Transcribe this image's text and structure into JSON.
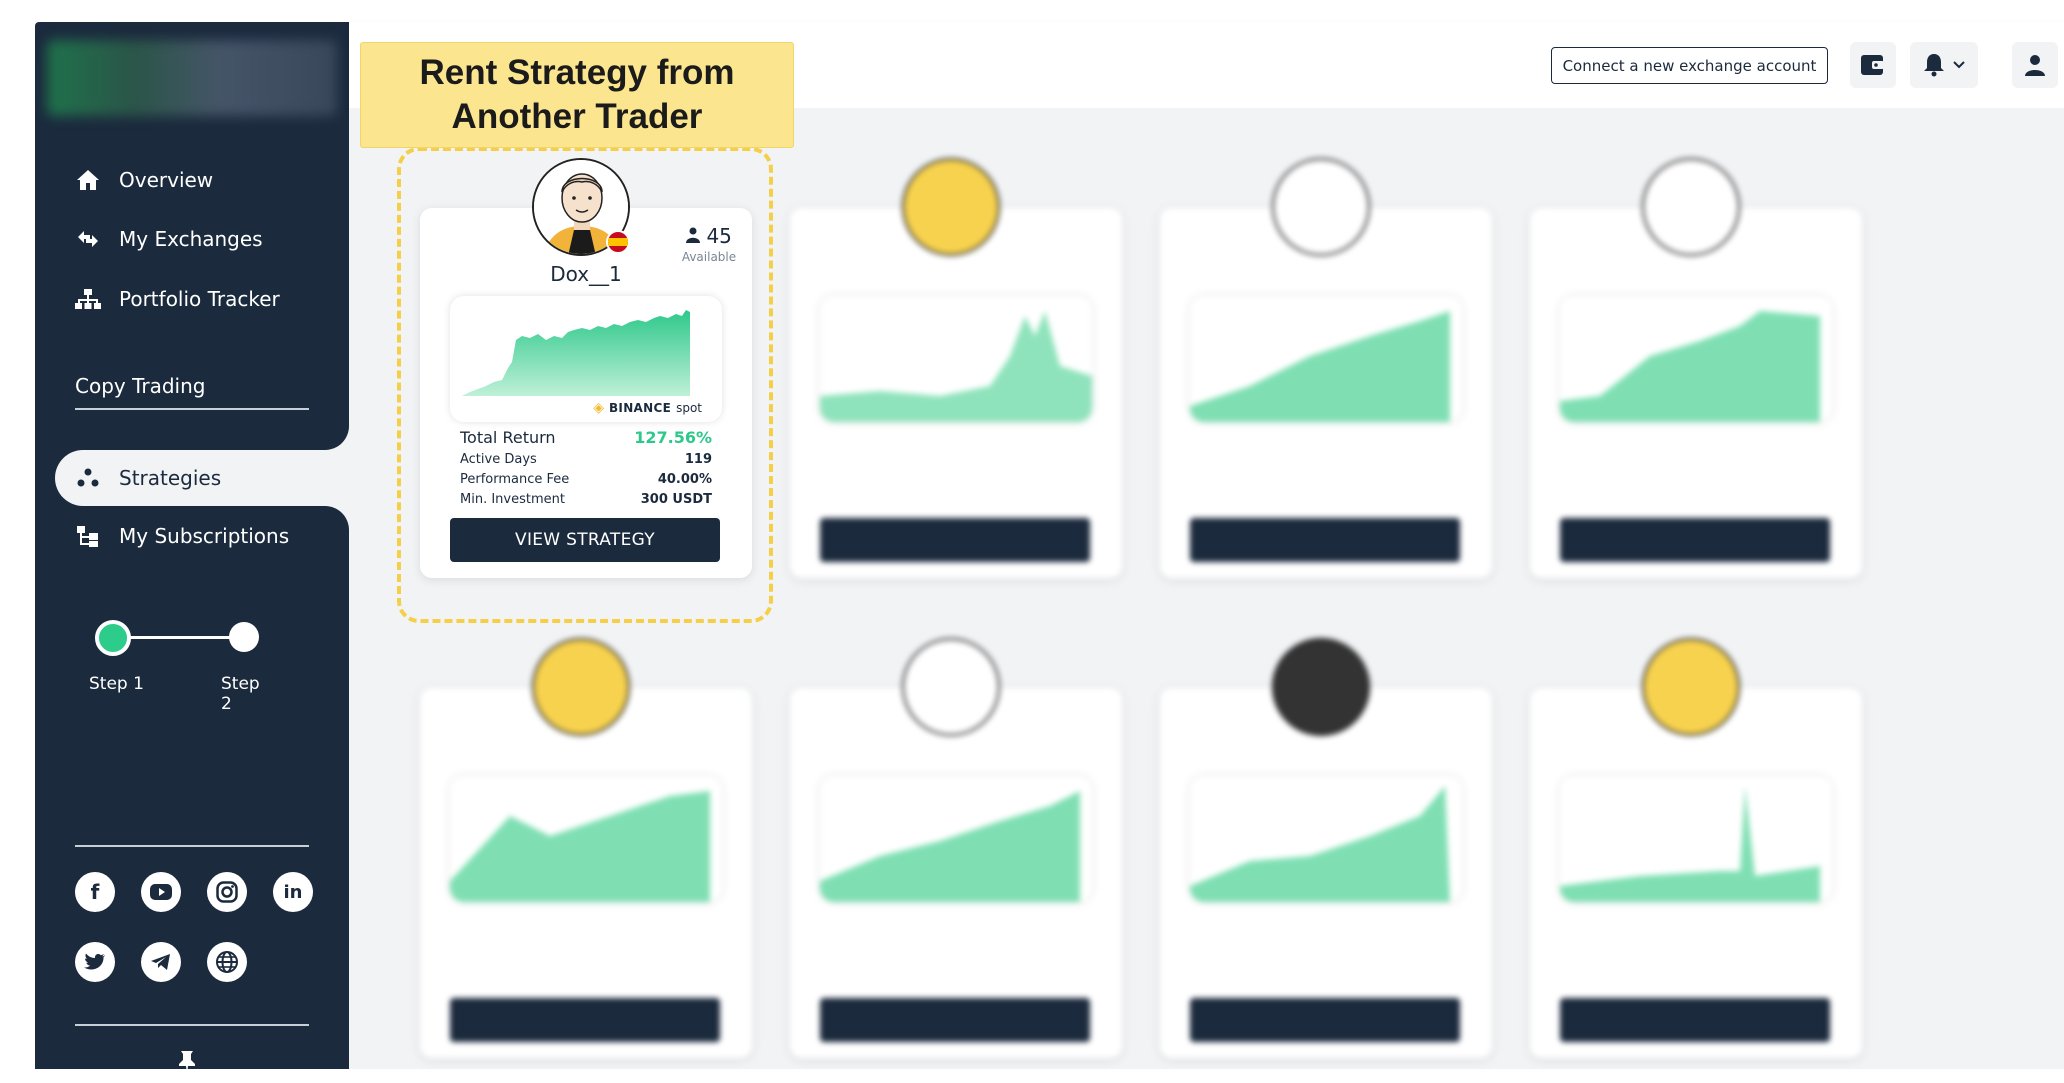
{
  "sidebar": {
    "nav": [
      {
        "label": "Overview",
        "icon": "home-icon"
      },
      {
        "label": "My Exchanges",
        "icon": "exchange-icon"
      },
      {
        "label": "Portfolio Tracker",
        "icon": "hierarchy-icon"
      }
    ],
    "section_title": "Copy Trading",
    "copy_nav": [
      {
        "label": "Strategies",
        "icon": "strategies-icon",
        "active": true
      },
      {
        "label": "My Subscriptions",
        "icon": "subscriptions-icon"
      }
    ],
    "steps": [
      {
        "label": "Step 1",
        "done": true
      },
      {
        "label": "Step 2",
        "done": false
      }
    ],
    "social": [
      "facebook-icon",
      "youtube-icon",
      "instagram-icon",
      "linkedin-icon",
      "twitter-icon",
      "telegram-icon",
      "globe-icon"
    ]
  },
  "topbar": {
    "connect_label": "Connect a new exchange account"
  },
  "banner": {
    "line1": "Rent Strategy from",
    "line2": "Another Trader"
  },
  "featured_card": {
    "trader": "Dox__1",
    "available_count": "45",
    "available_label": "Available",
    "exchange": "BINANCE",
    "market": "spot",
    "total_return_label": "Total Return",
    "total_return": "127.56%",
    "active_days_label": "Active Days",
    "active_days": "119",
    "performance_fee_label": "Performance Fee",
    "performance_fee": "40.00%",
    "min_investment_label": "Min. Investment",
    "min_investment": "300 USDT",
    "button_label": "VIEW STRATEGY"
  },
  "colors": {
    "sidebar": "#1b2a3d",
    "accent_green": "#2dc88a",
    "banner_yellow": "#fbe58e"
  }
}
